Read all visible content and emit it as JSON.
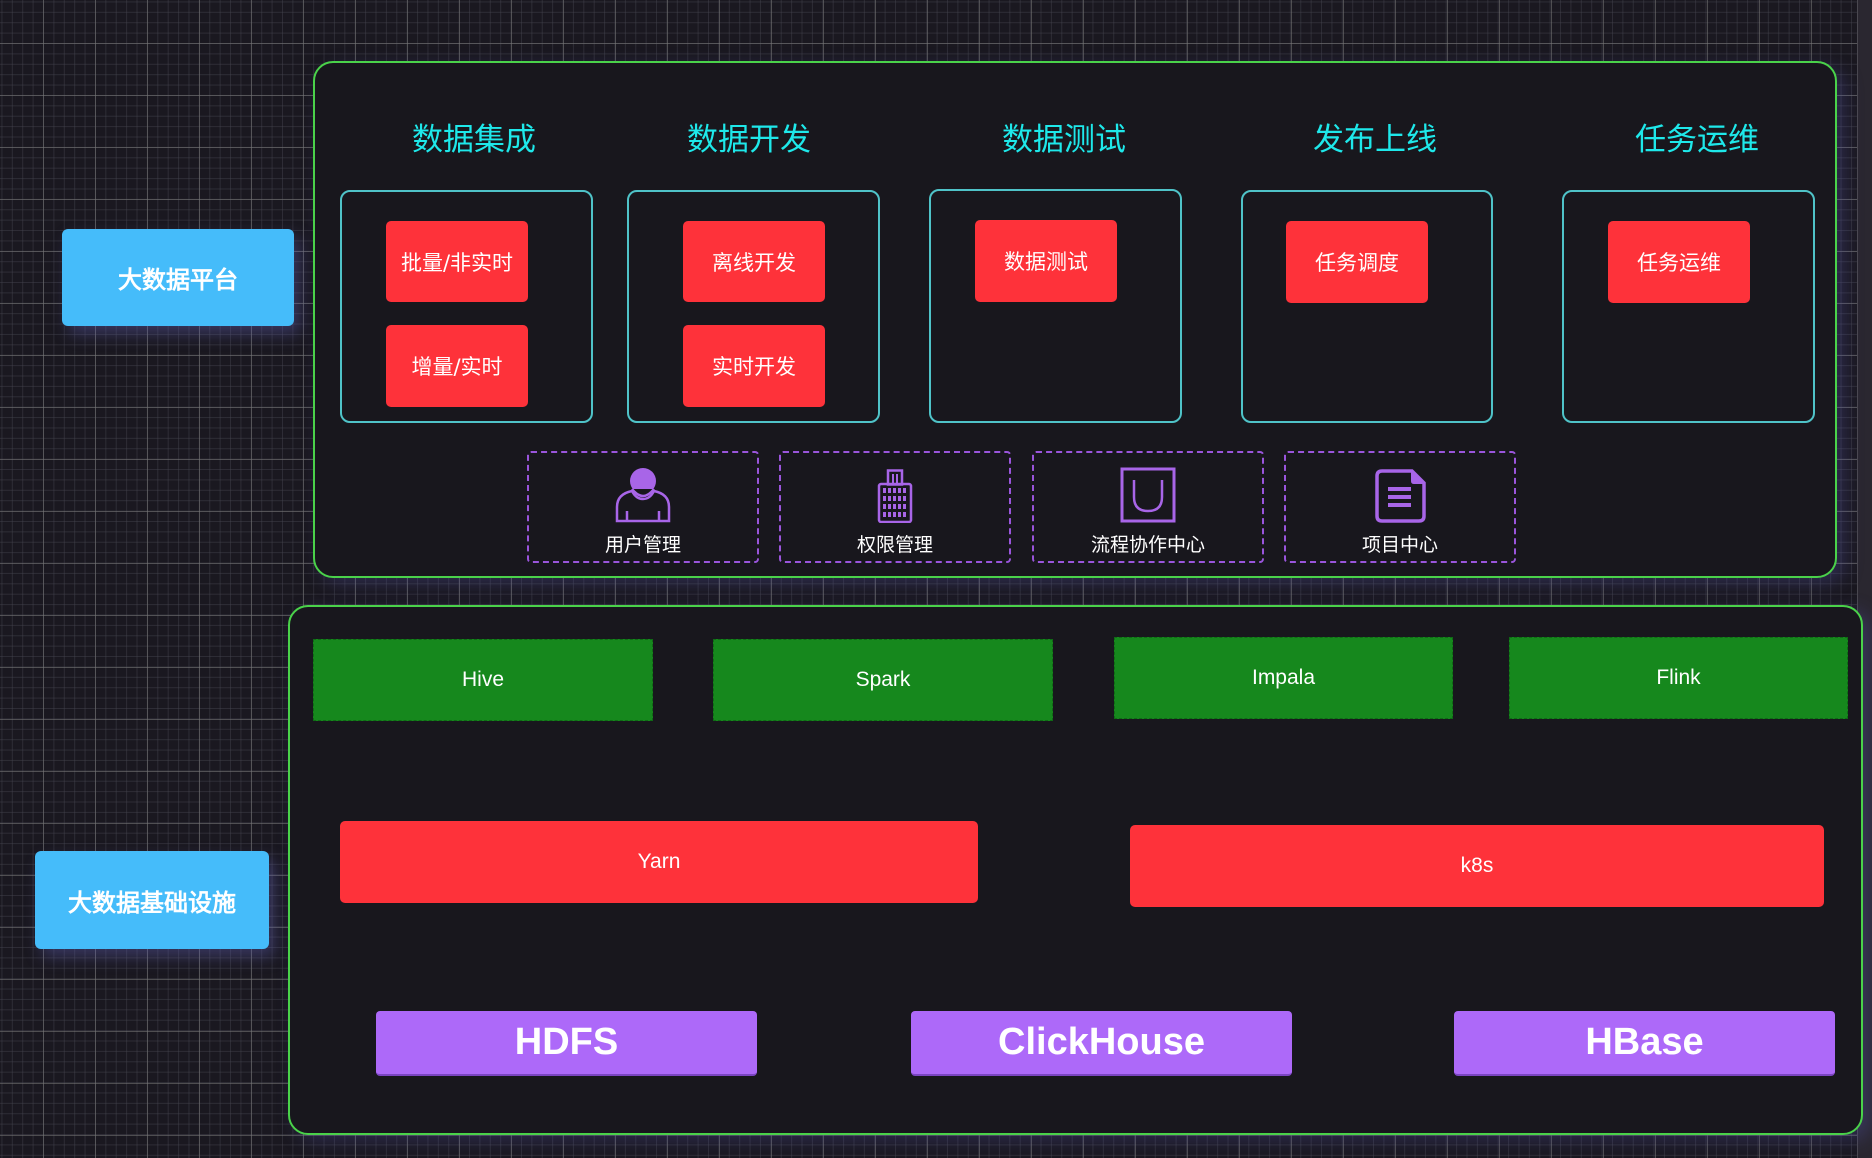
{
  "platform": {
    "label": "大数据平台",
    "columns": [
      {
        "title": "数据集成",
        "items": [
          "批量/非实时",
          "增量/实时"
        ]
      },
      {
        "title": "数据开发",
        "items": [
          "离线开发",
          "实时开发"
        ]
      },
      {
        "title": "数据测试",
        "items": [
          "数据测试"
        ]
      },
      {
        "title": "发布上线",
        "items": [
          "任务调度"
        ]
      },
      {
        "title": "任务运维",
        "items": [
          "任务运维"
        ]
      }
    ],
    "services": [
      {
        "label": "用户管理",
        "icon": "user-icon"
      },
      {
        "label": "权限管理",
        "icon": "building-icon"
      },
      {
        "label": "流程协作中心",
        "icon": "workflow-icon"
      },
      {
        "label": "项目中心",
        "icon": "document-icon"
      }
    ]
  },
  "infrastructure": {
    "label": "大数据基础设施",
    "compute_engines": [
      "Hive",
      "Spark",
      "Impala",
      "Flink"
    ],
    "schedulers": [
      "Yarn",
      "k8s"
    ],
    "storage": [
      "HDFS",
      "ClickHouse",
      "HBase"
    ]
  },
  "colors": {
    "title_cyan": "#1ee8ea",
    "label_blue": "#45bcfa",
    "module_red": "#fe323a",
    "engine_green": "#16881d",
    "storage_purple": "#ad69f9",
    "panel_border_green": "#4ad24a",
    "icon_purple": "#a865e8"
  }
}
